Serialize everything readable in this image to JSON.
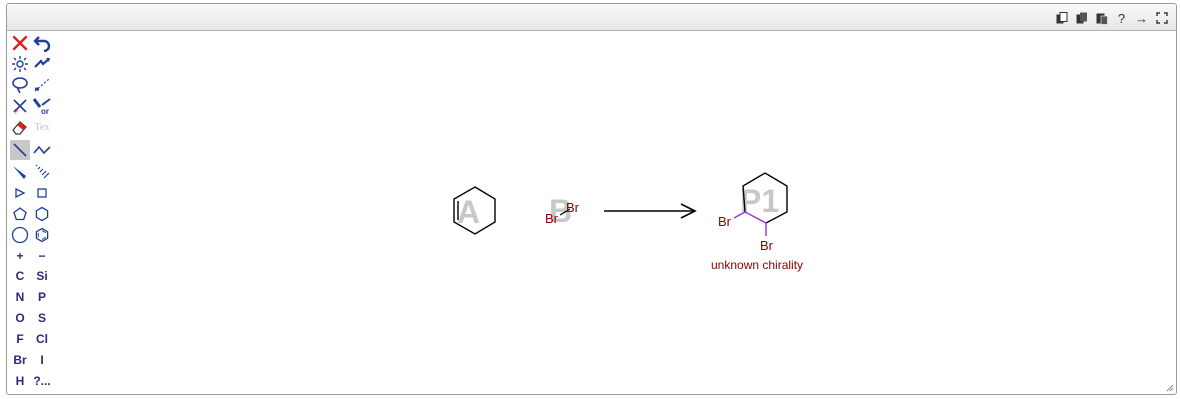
{
  "top_toolbar": {
    "icons": [
      "copy-icon",
      "copy-image-icon",
      "paste-icon",
      "help-icon",
      "export-icon",
      "fullscreen-icon"
    ],
    "help_label": "?",
    "export_label": "→"
  },
  "left_toolbar": {
    "tools": [
      "clear-tool",
      "undo-tool",
      "clean-tool",
      "redo-tool",
      "lasso-tool",
      "move-tool",
      "query-atom-tool",
      "query-or-tool",
      "erase-tool",
      "text-tool",
      "single-bond-tool",
      "chain-tool",
      "wedge-bond-tool",
      "hash-bond-tool",
      "triangle-tool",
      "square-tool",
      "pentagon-tool",
      "hexagon-tool",
      "heptagon-tool",
      "benzene-tool",
      "increase-charge-tool",
      "decrease-charge-tool"
    ],
    "text_label": "Tex",
    "or_label": "or",
    "selected": "single-bond-tool",
    "charge_plus": "+",
    "charge_minus": "−",
    "atoms": [
      [
        "C",
        "Si"
      ],
      [
        "N",
        "P"
      ],
      [
        "O",
        "S"
      ],
      [
        "F",
        "Cl"
      ],
      [
        "Br",
        "I"
      ],
      [
        "H",
        "?..."
      ]
    ]
  },
  "reaction": {
    "reactant_a_label": "A",
    "reactant_b_label": "B",
    "product_label": "P1",
    "br2_left": "Br",
    "br2_right": "Br",
    "product_br_left": "Br",
    "product_br_bottom": "Br",
    "stereo_note": "unknown chirality",
    "colors": {
      "atom_text": "#8b0000",
      "highlight_bond": "#9b30d9",
      "label_watermark": "#c8c8c8",
      "toolbar_icon": "#2b2b7a"
    }
  }
}
